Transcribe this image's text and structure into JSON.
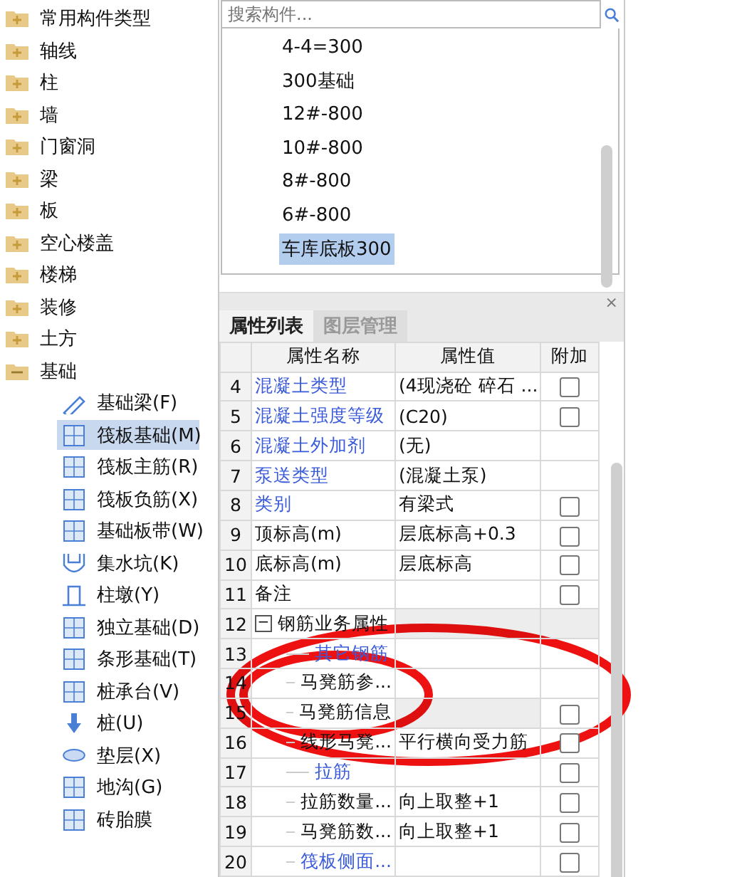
{
  "tree": {
    "items": [
      {
        "label": "常用构件类型",
        "expanded": false
      },
      {
        "label": "轴线",
        "expanded": false
      },
      {
        "label": "柱",
        "expanded": false
      },
      {
        "label": "墙",
        "expanded": false
      },
      {
        "label": "门窗洞",
        "expanded": false
      },
      {
        "label": "梁",
        "expanded": false
      },
      {
        "label": "板",
        "expanded": false
      },
      {
        "label": "空心楼盖",
        "expanded": false
      },
      {
        "label": "楼梯",
        "expanded": false
      },
      {
        "label": "装修",
        "expanded": false
      },
      {
        "label": "土方",
        "expanded": false
      },
      {
        "label": "基础",
        "expanded": true,
        "children": [
          {
            "label": "基础梁(F)",
            "selected": false
          },
          {
            "label": "筏板基础(M)",
            "selected": true
          },
          {
            "label": "筏板主筋(R)",
            "selected": false
          },
          {
            "label": "筏板负筋(X)",
            "selected": false
          },
          {
            "label": "基础板带(W)",
            "selected": false
          },
          {
            "label": "集水坑(K)",
            "selected": false
          },
          {
            "label": "柱墩(Y)",
            "selected": false
          },
          {
            "label": "独立基础(D)",
            "selected": false
          },
          {
            "label": "条形基础(T)",
            "selected": false
          },
          {
            "label": "桩承台(V)",
            "selected": false
          },
          {
            "label": "桩(U)",
            "selected": false
          },
          {
            "label": "垫层(X)",
            "selected": false
          },
          {
            "label": "地沟(G)",
            "selected": false
          },
          {
            "label": "砖胎膜",
            "selected": false
          }
        ]
      }
    ]
  },
  "search": {
    "placeholder": "搜索构件..."
  },
  "component_list": [
    {
      "label": "4-4=300",
      "selected": false
    },
    {
      "label": "300基础",
      "selected": false
    },
    {
      "label": "12#-800",
      "selected": false
    },
    {
      "label": "10#-800",
      "selected": false
    },
    {
      "label": "8#-800",
      "selected": false
    },
    {
      "label": "6#-800",
      "selected": false
    },
    {
      "label": "车库底板300",
      "selected": true
    }
  ],
  "panel": {
    "close": "×",
    "tabs": [
      {
        "label": "属性列表",
        "selected": true
      },
      {
        "label": "图层管理",
        "selected": false
      }
    ]
  },
  "table": {
    "columns": [
      "",
      "属性名称",
      "属性值",
      "附加"
    ],
    "rows": [
      {
        "num": "4",
        "name": "混凝土类型",
        "value": "(4现浇砼 碎石 ...",
        "kind": "link",
        "checked": false
      },
      {
        "num": "5",
        "name": "混凝土强度等级",
        "value": "(C20)",
        "kind": "link",
        "checked": false
      },
      {
        "num": "6",
        "name": "混凝土外加剂",
        "value": "(无)",
        "kind": "link"
      },
      {
        "num": "7",
        "name": "泵送类型",
        "value": "(混凝土泵)",
        "kind": "link"
      },
      {
        "num": "8",
        "name": "类别",
        "value": "有梁式",
        "kind": "link",
        "checked": false
      },
      {
        "num": "9",
        "name": "顶标高(m)",
        "value": "层底标高+0.3",
        "kind": "plain",
        "checked": false
      },
      {
        "num": "10",
        "name": "底标高(m)",
        "value": "层底标高",
        "kind": "plain",
        "checked": false
      },
      {
        "num": "11",
        "name": "备注",
        "kind": "plain",
        "checked": false
      },
      {
        "num": "12",
        "name": "钢筋业务属性",
        "kind": "group",
        "expanded": true,
        "toggle": "−",
        "children": [
          {
            "num": "13",
            "name": "其它钢筋",
            "kind": "link"
          },
          {
            "num": "14",
            "name": "马凳筋参...",
            "kind": "plain"
          },
          {
            "num": "15",
            "name": "马凳筋信息",
            "kind": "group",
            "checked": false
          },
          {
            "num": "16",
            "name": "线形马凳...",
            "value": "平行横向受力筋",
            "kind": "plain",
            "checked": false
          },
          {
            "num": "17",
            "name": "拉筋",
            "kind": "link",
            "checked": false
          },
          {
            "num": "18",
            "name": "拉筋数量...",
            "value": "向上取整+1",
            "kind": "plain",
            "checked": false
          },
          {
            "num": "19",
            "name": "马凳筋数...",
            "value": "向上取整+1",
            "kind": "plain",
            "checked": false
          },
          {
            "num": "20",
            "name": "筏板侧面...",
            "kind": "link",
            "checked": false
          }
        ]
      }
    ]
  }
}
